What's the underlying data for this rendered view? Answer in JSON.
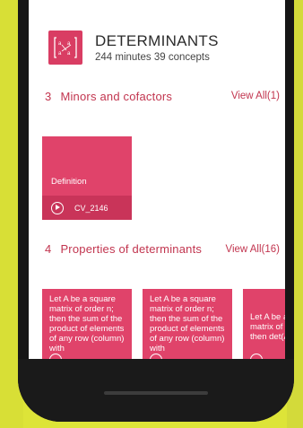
{
  "header": {
    "title": "DETERMINANTS",
    "subtitle": "244 minutes 39 concepts"
  },
  "sections": [
    {
      "number": "3",
      "title": "Minors and cofactors",
      "view_all": "View All(1)",
      "cards": [
        {
          "label": "Definition",
          "code": "CV_2146"
        }
      ]
    },
    {
      "number": "4",
      "title": "Properties of determinants",
      "view_all": "View All(16)",
      "cards": [
        {
          "text": "Let A be a square matrix of order n; then the sum of the product of elements of any row (column) with"
        },
        {
          "text": "Let A be a square matrix of order n; then the sum of the product of elements of any row (column) with"
        },
        {
          "text": "Let A be a square matrix of order n then det(A) ="
        }
      ]
    }
  ],
  "colors": {
    "background": "#dde438",
    "accent": "#e0436a",
    "accent_dark": "#c93459",
    "section_text": "#c2354f"
  }
}
